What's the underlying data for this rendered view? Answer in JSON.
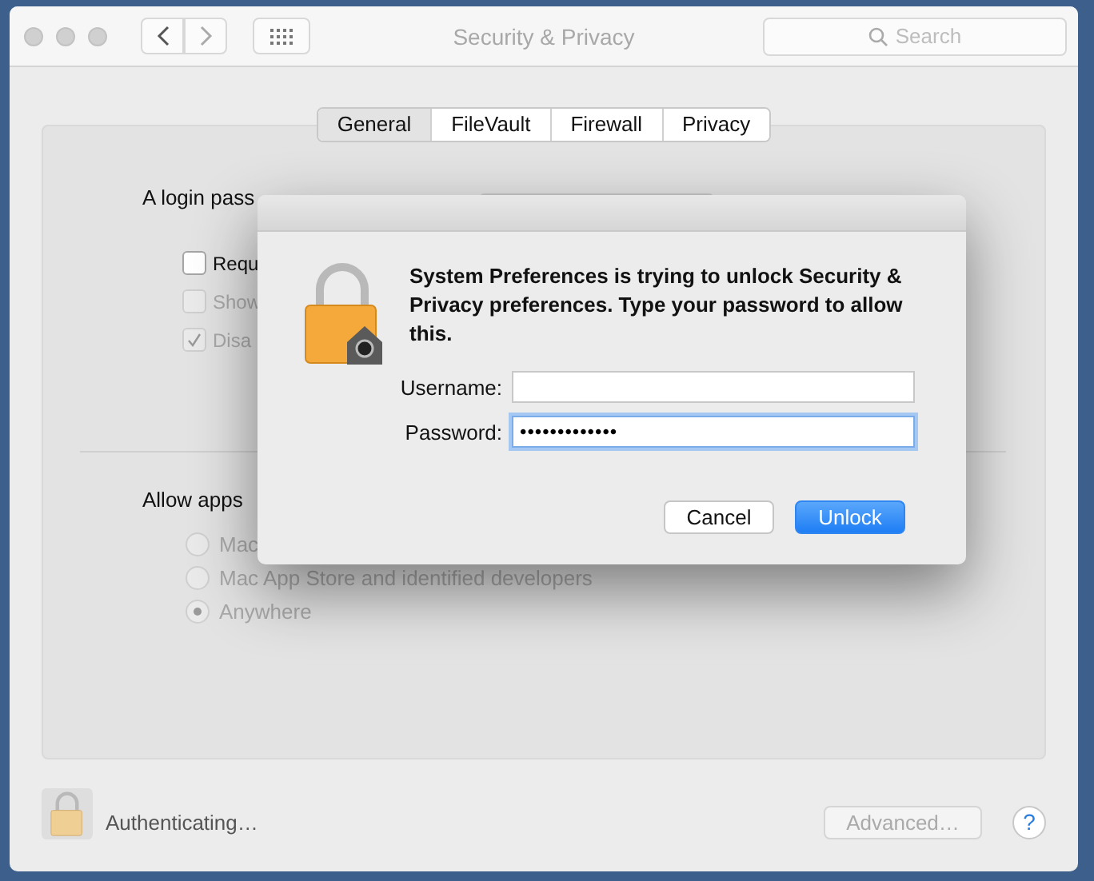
{
  "window": {
    "title": "Security & Privacy"
  },
  "search": {
    "placeholder": "Search"
  },
  "tabs": [
    {
      "label": "General",
      "selected": true
    },
    {
      "label": "FileVault",
      "selected": false
    },
    {
      "label": "Firewall",
      "selected": false
    },
    {
      "label": "Privacy",
      "selected": false
    }
  ],
  "general": {
    "login_text": "A login pass",
    "checkboxes": [
      {
        "label": "Requ",
        "checked": false,
        "disabled": false
      },
      {
        "label": "Show",
        "checked": false,
        "disabled": true
      },
      {
        "label": "Disa",
        "checked": true,
        "disabled": true
      }
    ],
    "allow_apps_label": "Allow apps",
    "radios": [
      {
        "label": "Mac",
        "selected": false,
        "disabled": true
      },
      {
        "label": "Mac App Store and identified developers",
        "selected": false,
        "disabled": true
      },
      {
        "label": "Anywhere",
        "selected": true,
        "disabled": true
      }
    ]
  },
  "footer": {
    "status": "Authenticating…",
    "advanced_button": {
      "label": "Advanced…",
      "disabled": true
    },
    "help": "?"
  },
  "dialog": {
    "message": "System Preferences is trying to unlock Security & Privacy preferences. Type your password to allow this.",
    "fields": [
      {
        "label": "Username:",
        "focused": false
      },
      {
        "label": "Password:",
        "value": "•••••••••••••",
        "focused": true
      }
    ],
    "buttons": [
      {
        "label": "Cancel",
        "default": false
      },
      {
        "label": "Unlock",
        "default": true
      }
    ]
  }
}
